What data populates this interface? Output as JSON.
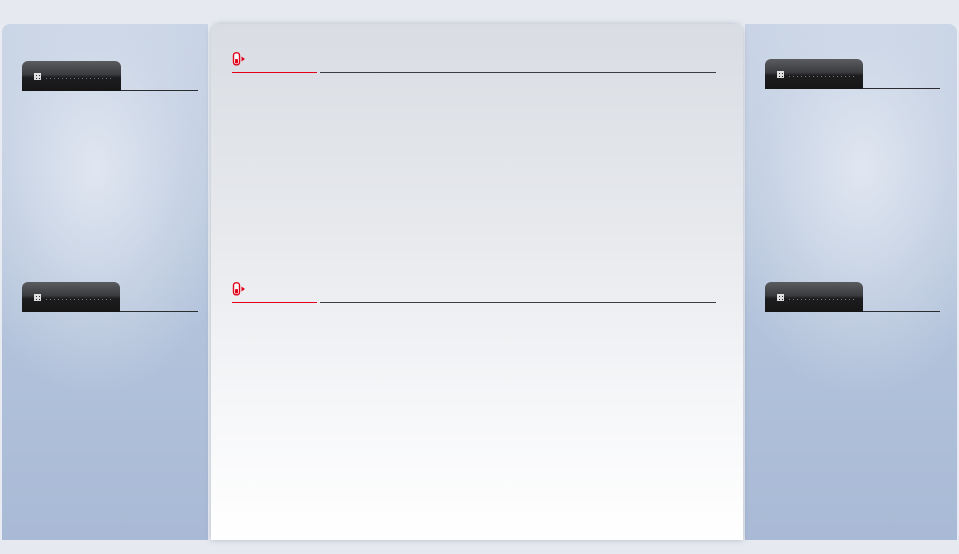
{
  "colors": {
    "accent": "#e2001a",
    "panel_bg": "#b4c4dc",
    "tab_dark": "#1d1d1f"
  },
  "left_column": {
    "tabs": [
      {
        "icon": "grid-icon",
        "label": ""
      },
      {
        "icon": "grid-icon",
        "label": ""
      }
    ]
  },
  "right_column": {
    "tabs": [
      {
        "icon": "grid-icon",
        "label": ""
      },
      {
        "icon": "grid-icon",
        "label": ""
      }
    ]
  },
  "main": {
    "sections": [
      {
        "icon": "bookmark-arrow-icon",
        "title": ""
      },
      {
        "icon": "bookmark-arrow-icon",
        "title": ""
      }
    ]
  }
}
